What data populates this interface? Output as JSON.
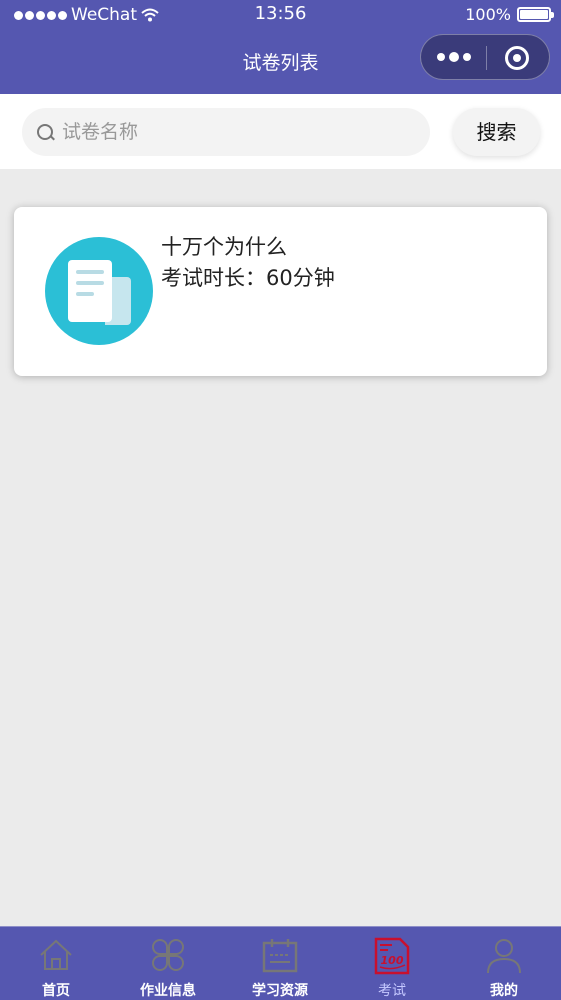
{
  "status_bar": {
    "carrier": "WeChat",
    "time": "13:56",
    "battery": "100%"
  },
  "nav": {
    "title": "试卷列表"
  },
  "search": {
    "placeholder": "试卷名称",
    "value": "",
    "button_label": "搜索"
  },
  "exams": [
    {
      "title": "十万个为什么",
      "duration": "考试时长：60分钟"
    }
  ],
  "tabbar": {
    "items": [
      {
        "label": "首页",
        "icon": "home-icon"
      },
      {
        "label": "作业信息",
        "icon": "grid-icon"
      },
      {
        "label": "学习资源",
        "icon": "calendar-icon"
      },
      {
        "label": "考试",
        "icon": "exam-paper-icon",
        "active": true
      },
      {
        "label": "我的",
        "icon": "user-icon"
      }
    ],
    "active_color": "#c5c8ff"
  },
  "colors": {
    "brand": "#5557b0",
    "card_icon_bg": "#2bbfd6",
    "background": "#ebebeb"
  }
}
